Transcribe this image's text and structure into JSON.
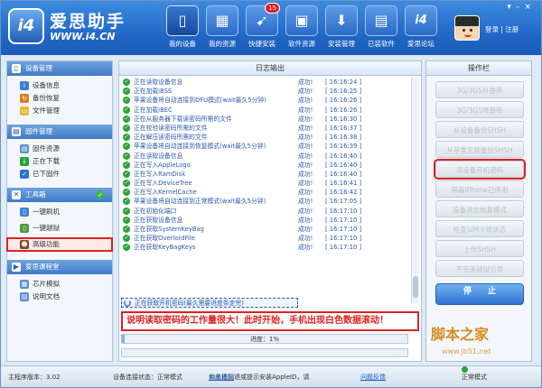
{
  "header": {
    "logo_badge": "i4",
    "app_title": "爱思助手",
    "app_url": "WWW.i4.CN",
    "nav": [
      {
        "label": "我的设备",
        "icon": "device-icon",
        "active": true
      },
      {
        "label": "我的资源",
        "icon": "resources-icon",
        "active": false
      },
      {
        "label": "快捷安装",
        "icon": "quick-install-icon",
        "active": false,
        "badge": "15"
      },
      {
        "label": "软件资源",
        "icon": "software-icon",
        "active": false
      },
      {
        "label": "安装管理",
        "icon": "install-manage-icon",
        "active": false
      },
      {
        "label": "已装软件",
        "icon": "installed-icon",
        "active": false
      },
      {
        "label": "爱思论坛",
        "icon": "forum-icon",
        "active": false
      }
    ],
    "login_text": "登录 | 注册"
  },
  "sidebar": {
    "sections": [
      {
        "title": "设备管理",
        "items": [
          "设备信息",
          "备份恢复",
          "文件管理"
        ]
      },
      {
        "title": "固件管理",
        "items": [
          "固件资源",
          "正在下载",
          "已下固件"
        ]
      },
      {
        "title": "工具箱",
        "items": [
          "一键刷机",
          "一键越狱",
          "高级功能"
        ]
      },
      {
        "title": "爱思课程堂",
        "items": [
          "芯片模拟",
          "说明文档"
        ]
      }
    ],
    "selected_item": "高级功能"
  },
  "log": {
    "title": "日志输出",
    "rows": [
      {
        "msg": "正在读取设备信息",
        "status": "成功!",
        "time": "[ 16:16:24 ]"
      },
      {
        "msg": "正在加载iBSS",
        "status": "成功!",
        "time": "[ 16:16:25 ]"
      },
      {
        "msg": "苹果设备将自动连接到DFU模式(wait最久5分钟)",
        "status": "成功!",
        "time": "[ 16:16:26 ]"
      },
      {
        "msg": "正在加载iBEC",
        "status": "成功!",
        "time": "[ 16:16:26 ]"
      },
      {
        "msg": "正在从服务器下载读密码所需的文件",
        "status": "成功!",
        "time": "[ 16:16:30 ]"
      },
      {
        "msg": "正在校验读密码所需的文件",
        "status": "成功!",
        "time": "[ 16:16:37 ]"
      },
      {
        "msg": "正在解压读密码所需的文件",
        "status": "成功!",
        "time": "[ 16:16:38 ]"
      },
      {
        "msg": "苹果设备将自动连接到恢复模式(wait最久5分钟)",
        "status": "成功!",
        "time": "[ 16:16:39 ]"
      },
      {
        "msg": "正在读取设备信息",
        "status": "成功!",
        "time": "[ 16:16:40 ]"
      },
      {
        "msg": "正在写入AppleLogo",
        "status": "成功!",
        "time": "[ 16:16:40 ]"
      },
      {
        "msg": "正在写入RamDisk",
        "status": "成功!",
        "time": "[ 16:16:40 ]"
      },
      {
        "msg": "正在写入DeviceTree",
        "status": "成功!",
        "time": "[ 16:16:41 ]"
      },
      {
        "msg": "正在写入KernelCache",
        "status": "成功!",
        "time": "[ 16:16:42 ]"
      },
      {
        "msg": "苹果设备将自动连接到正常模式(wait最久5分钟)",
        "status": "成功!",
        "time": "[ 16:17:05 ]"
      },
      {
        "msg": "正在初始化端口",
        "status": "成功!",
        "time": "[ 16:17:10 ]"
      },
      {
        "msg": "正在获取设备信息",
        "status": "成功!",
        "time": "[ 16:17:10 ]"
      },
      {
        "msg": "正在获取SystemKeyBag",
        "status": "成功!",
        "time": "[ 16:17:10 ]"
      },
      {
        "msg": "正在获取OverlordFile",
        "status": "成功!",
        "time": "[ 16:17:10 ]"
      },
      {
        "msg": "正在获取KeyBagKeys",
        "status": "成功!",
        "time": "[ 16:17:10 ]"
      }
    ],
    "current_row": "正在获取开机密码(最久需要进度条走完)",
    "note": "说明读取密码的工作量很大！此时开始，手机出现白色数据滚动！",
    "progress_text": "进度：1%",
    "progress_fraction": 0.01
  },
  "ops": {
    "title": "操作栏",
    "buttons": [
      "3G/3GS升基带",
      "3G/3GS降基带",
      "从设备备份SHSH",
      "从苹果官网备份SHSH",
      "读设备开机密码",
      "屏蔽iPhone已停用",
      "设备退出恢复模式",
      "检查SIM卡锁状态",
      "上传SHSH",
      "不完美越狱引导"
    ],
    "highlighted": "读设备开机密码",
    "stop_label": "停　　止"
  },
  "watermark": {
    "text": "脚本之家",
    "sub": "www.jb51.net"
  },
  "statusbar": {
    "version": "主程序版本：3.02",
    "conn_status": "设备连接状态：正常模式",
    "hint": "如出现闪退或提示安装AppleID，请",
    "help_link": "点此修复",
    "feedback": "问题反馈",
    "mode": "正常模式"
  },
  "colors": {
    "accent": "#1f64c4",
    "highlight": "#dd2222",
    "ok": "#2aa33a"
  }
}
